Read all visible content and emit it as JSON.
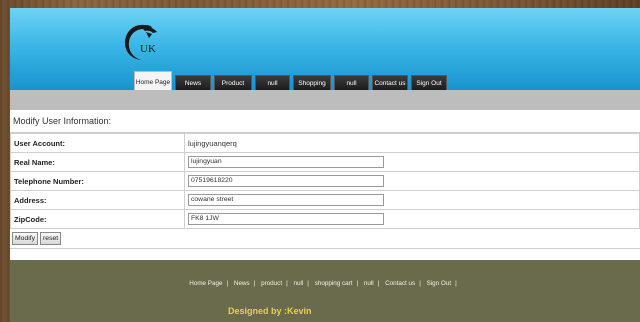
{
  "nav": {
    "tabs": [
      "Home Page",
      "News",
      "Product",
      "null",
      "Shopping cart",
      "null",
      "Contact us",
      "Sign Out"
    ]
  },
  "logo": {
    "text": "UK"
  },
  "form": {
    "title": "Modify User Information:",
    "fields": [
      {
        "label": "User Account:",
        "value": "lujingyuanqerq"
      },
      {
        "label": "Real Name:",
        "value": "lujingyuan"
      },
      {
        "label": "Telephone Number:",
        "value": "07519618220"
      },
      {
        "label": "Address:",
        "value": "cowane street"
      },
      {
        "label": "ZipCode:",
        "value": "FK8 1JW"
      }
    ],
    "buttons": {
      "modify": "Modify",
      "reset": "reset"
    }
  },
  "footer": {
    "links": [
      "Home Page",
      "News",
      "product",
      "null",
      "shopping cart",
      "null",
      "Contact us",
      "Sign Out"
    ],
    "credit": "Designed by :Kevin"
  },
  "colors": {
    "header": "#1993cf",
    "footer": "#6a6a4d",
    "credit": "#e6d34a"
  }
}
